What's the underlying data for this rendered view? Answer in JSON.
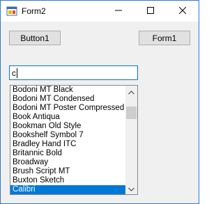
{
  "window": {
    "title": "Form2"
  },
  "icons": {
    "app": "form-icon",
    "minimize": "minimize-icon",
    "maximize": "maximize-icon",
    "close": "close-icon",
    "scroll_up": "scroll-up-icon",
    "scroll_down": "scroll-down-icon"
  },
  "buttons": {
    "button1": "Button1",
    "form1": "Form1"
  },
  "search": {
    "value": "c"
  },
  "fonts_list": {
    "items": [
      "Bodoni MT Black",
      "Bodoni MT Condensed",
      "Bodoni MT Poster Compressed",
      "Book Antiqua",
      "Bookman Old Style",
      "Bookshelf Symbol 7",
      "Bradley Hand ITC",
      "Britannic Bold",
      "Broadway",
      "Brush Script MT",
      "Buxton Sketch",
      "Calibri"
    ],
    "selected": "Calibri"
  },
  "colors": {
    "selection": "#0078d7",
    "focus_border": "#0078d7",
    "window_border": "#2b79d6"
  }
}
